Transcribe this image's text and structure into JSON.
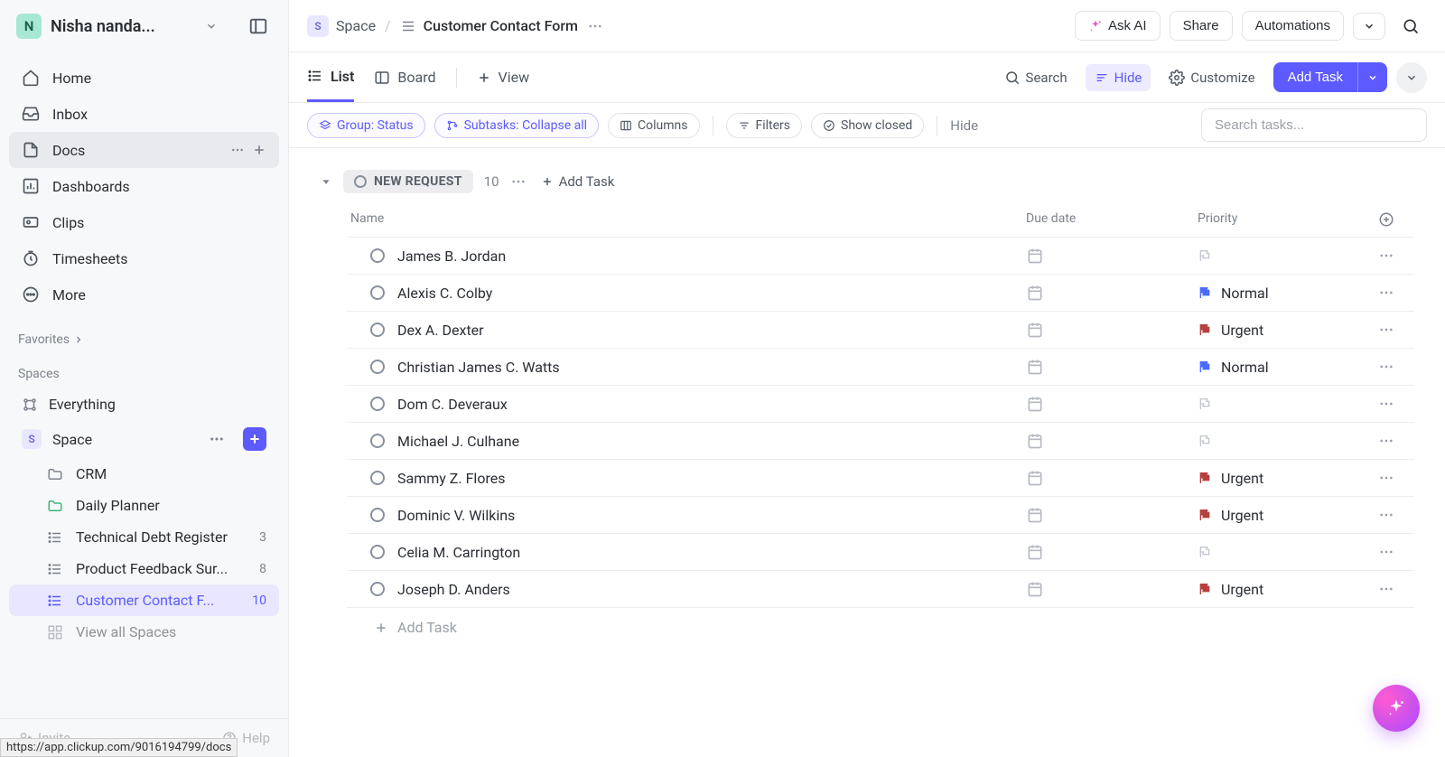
{
  "workspace": {
    "initial": "N",
    "name": "Nisha nanda..."
  },
  "sidebar": {
    "nav": [
      {
        "icon": "home",
        "label": "Home"
      },
      {
        "icon": "inbox",
        "label": "Inbox"
      },
      {
        "icon": "doc",
        "label": "Docs",
        "active": true
      },
      {
        "icon": "dashboard",
        "label": "Dashboards"
      },
      {
        "icon": "clip",
        "label": "Clips"
      },
      {
        "icon": "timesheet",
        "label": "Timesheets"
      },
      {
        "icon": "more",
        "label": "More"
      }
    ],
    "favorites_label": "Favorites",
    "spaces_label": "Spaces",
    "everything_label": "Everything",
    "space": {
      "initial": "S",
      "label": "Space"
    },
    "lists": [
      {
        "icon": "folder",
        "label": "CRM",
        "count": ""
      },
      {
        "icon": "folder-green",
        "label": "Daily Planner",
        "count": ""
      },
      {
        "icon": "list",
        "label": "Technical Debt Register",
        "count": "3"
      },
      {
        "icon": "list",
        "label": "Product Feedback Sur...",
        "count": "8"
      },
      {
        "icon": "list",
        "label": "Customer Contact F...",
        "count": "10",
        "selected": true
      }
    ],
    "view_all": "View all Spaces",
    "invite": "Invite",
    "help": "Help"
  },
  "tooltip_url": "https://app.clickup.com/9016194799/docs",
  "breadcrumb": {
    "space_initial": "S",
    "space_label": "Space",
    "list_label": "Customer Contact Form"
  },
  "topbar": {
    "ask_ai": "Ask AI",
    "share": "Share",
    "automations": "Automations"
  },
  "views": {
    "list": "List",
    "board": "Board",
    "add_view": "View"
  },
  "viewbar": {
    "search": "Search",
    "hide": "Hide",
    "customize": "Customize",
    "add_task": "Add Task"
  },
  "filters": {
    "group": "Group: Status",
    "subtasks": "Subtasks: Collapse all",
    "columns": "Columns",
    "filters": "Filters",
    "show_closed": "Show closed",
    "hide": "Hide",
    "search_placeholder": "Search tasks..."
  },
  "group": {
    "status": "NEW REQUEST",
    "count": "10",
    "add_task": "Add Task"
  },
  "columns": {
    "name": "Name",
    "due": "Due date",
    "priority": "Priority"
  },
  "tasks": [
    {
      "name": "James B. Jordan",
      "priority": ""
    },
    {
      "name": "Alexis C. Colby",
      "priority": "Normal"
    },
    {
      "name": "Dex A. Dexter",
      "priority": "Urgent"
    },
    {
      "name": "Christian James C. Watts",
      "priority": "Normal"
    },
    {
      "name": "Dom C. Deveraux",
      "priority": ""
    },
    {
      "name": "Michael J. Culhane",
      "priority": ""
    },
    {
      "name": "Sammy Z. Flores",
      "priority": "Urgent"
    },
    {
      "name": "Dominic V. Wilkins",
      "priority": "Urgent"
    },
    {
      "name": "Celia M. Carrington",
      "priority": ""
    },
    {
      "name": "Joseph D. Anders",
      "priority": "Urgent"
    }
  ],
  "add_task_row": "Add Task"
}
